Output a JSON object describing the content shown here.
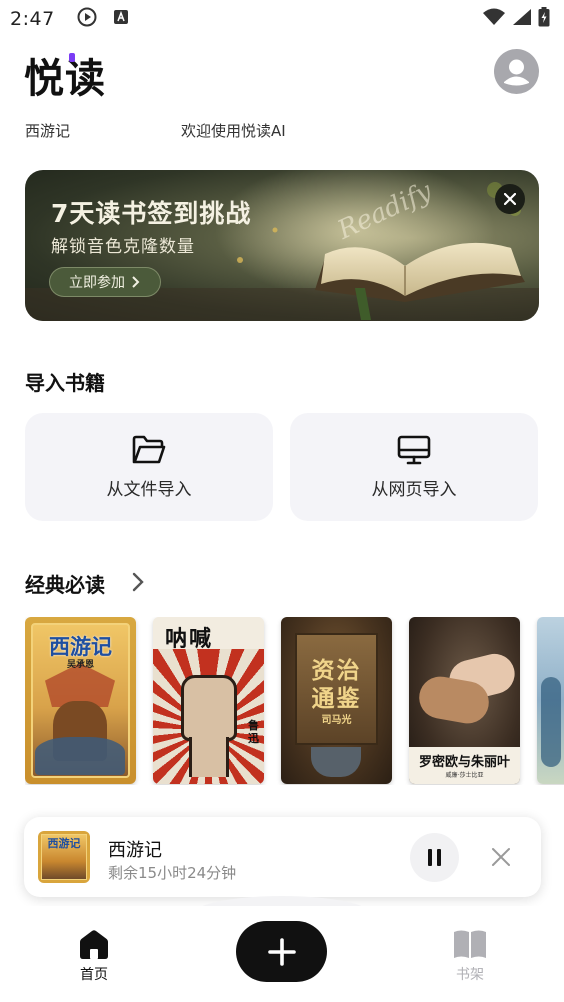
{
  "status_bar": {
    "time": "2:47"
  },
  "header": {
    "app_title": "悦读"
  },
  "subline": {
    "book": "西游记",
    "welcome": "欢迎使用悦读AI"
  },
  "banner": {
    "title": "7天读书签到挑战",
    "subtitle": "解锁音色克隆数量",
    "button_label": "立即参加",
    "script_text": "Readify"
  },
  "import_section": {
    "title": "导入书籍",
    "cards": [
      {
        "label": "从文件导入",
        "icon": "folder-icon"
      },
      {
        "label": "从网页导入",
        "icon": "monitor-icon"
      }
    ]
  },
  "classics_section": {
    "title": "经典必读",
    "books": [
      {
        "title": "西游记",
        "author": "吴承恩"
      },
      {
        "title": "呐喊",
        "author": "鲁迅"
      },
      {
        "title_line1": "资治",
        "title_line2": "通鉴",
        "author": "司马光"
      },
      {
        "title": "罗密欧与朱丽叶",
        "author": "威廉·莎士比亚"
      }
    ]
  },
  "player": {
    "title": "西游记",
    "remaining": "剩余15小时24分钟",
    "cover_title": "西游记"
  },
  "bottom_nav": {
    "home_label": "首页",
    "shelf_label": "书架"
  },
  "colors": {
    "accent": "#7b3cf5",
    "nav_active": "#111111",
    "nav_inactive": "#b0b0b5"
  }
}
